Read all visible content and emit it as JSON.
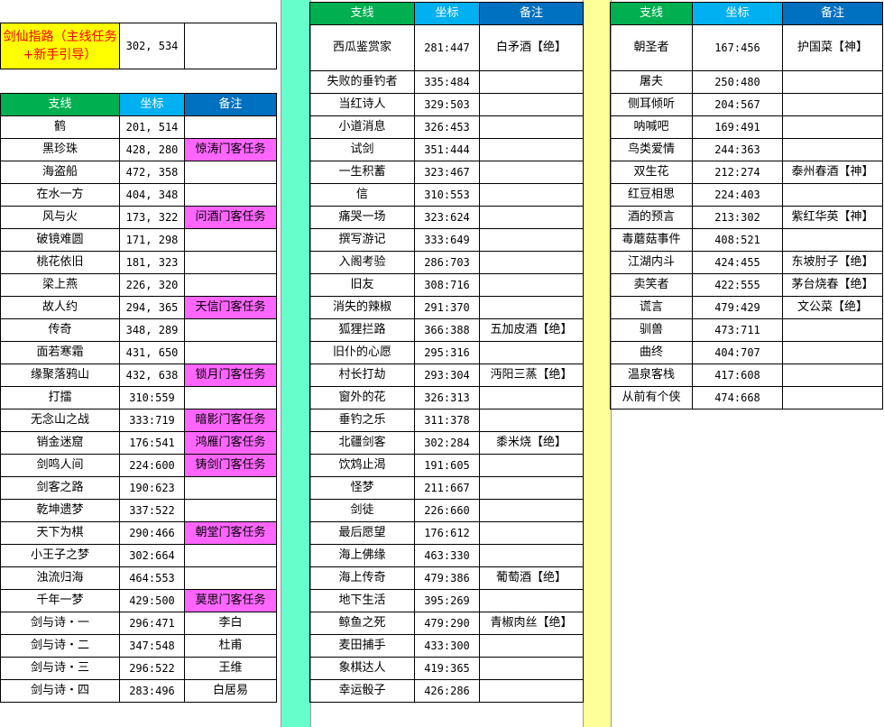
{
  "colors": {
    "header_green": "#00b050",
    "header_blue": "#00b0f0",
    "header_navy": "#0070c0",
    "mint_separator": "#66ffcc",
    "pale_yellow_separator": "#ffff99",
    "pink_note": "#ff66ff",
    "guide_yellow": "#ffff00",
    "guide_red_text": "#ff0000"
  },
  "guide": {
    "label": "剑仙指路（主线任务+新手引导）",
    "coord": "302, 534",
    "note": ""
  },
  "headers": {
    "branch": "支线",
    "coord": "坐标",
    "note": "备注"
  },
  "table1": [
    {
      "name": "鹤",
      "coord": "201, 514",
      "note": ""
    },
    {
      "name": "黑珍珠",
      "coord": "428, 280",
      "note": "惊涛门客任务"
    },
    {
      "name": "海盗船",
      "coord": "472, 358",
      "note": ""
    },
    {
      "name": "在水一方",
      "coord": "404, 348",
      "note": ""
    },
    {
      "name": "风与火",
      "coord": "173, 322",
      "note": "问酒门客任务"
    },
    {
      "name": "破镜难圆",
      "coord": "171, 298",
      "note": ""
    },
    {
      "name": "桃花依旧",
      "coord": "181, 323",
      "note": ""
    },
    {
      "name": "梁上燕",
      "coord": "226, 320",
      "note": ""
    },
    {
      "name": "故人约",
      "coord": "294, 365",
      "note": "天信门客任务"
    },
    {
      "name": "传奇",
      "coord": "348, 289",
      "note": ""
    },
    {
      "name": "面若寒霜",
      "coord": "431, 650",
      "note": ""
    },
    {
      "name": "缘聚落鸦山",
      "coord": "432, 638",
      "note": "锁月门客任务"
    },
    {
      "name": "打擂",
      "coord": "310:559",
      "note": ""
    },
    {
      "name": "无念山之战",
      "coord": "333:719",
      "note": "暗影门客任务"
    },
    {
      "name": "销金迷窟",
      "coord": "176:541",
      "note": "鸿雁门客任务"
    },
    {
      "name": "剑鸣人间",
      "coord": "224:600",
      "note": "铸剑门客任务"
    },
    {
      "name": "剑客之路",
      "coord": "190:623",
      "note": ""
    },
    {
      "name": "乾坤遗梦",
      "coord": "337:522",
      "note": ""
    },
    {
      "name": "天下为棋",
      "coord": "290:466",
      "note": "朝堂门客任务"
    },
    {
      "name": "小王子之梦",
      "coord": "302:664",
      "note": ""
    },
    {
      "name": "浊流归海",
      "coord": "464:553",
      "note": ""
    },
    {
      "name": "千年一梦",
      "coord": "429:500",
      "note": "莫思门客任务"
    },
    {
      "name": "剑与诗・一",
      "coord": "296:471",
      "note": "李白"
    },
    {
      "name": "剑与诗・二",
      "coord": "347:548",
      "note": "杜甫"
    },
    {
      "name": "剑与诗・三",
      "coord": "296:522",
      "note": "王维"
    },
    {
      "name": "剑与诗・四",
      "coord": "283:496",
      "note": "白居易"
    }
  ],
  "table2": [
    {
      "name": "西瓜鉴赏家",
      "coord": "281:447",
      "note": "白矛酒【绝】"
    },
    {
      "name": "失败的垂钓者",
      "coord": "335:484",
      "note": ""
    },
    {
      "name": "当红诗人",
      "coord": "329:503",
      "note": ""
    },
    {
      "name": "小道消息",
      "coord": "326:453",
      "note": ""
    },
    {
      "name": "试剑",
      "coord": "351:444",
      "note": ""
    },
    {
      "name": "一生积蓄",
      "coord": "323:467",
      "note": ""
    },
    {
      "name": "信",
      "coord": "310:553",
      "note": ""
    },
    {
      "name": "痛哭一场",
      "coord": "323:624",
      "note": ""
    },
    {
      "name": "撰写游记",
      "coord": "333:649",
      "note": ""
    },
    {
      "name": "入阁考验",
      "coord": "286:703",
      "note": ""
    },
    {
      "name": "旧友",
      "coord": "308:716",
      "note": ""
    },
    {
      "name": "消失的辣椒",
      "coord": "291:370",
      "note": ""
    },
    {
      "name": "狐狸拦路",
      "coord": "366:388",
      "note": "五加皮酒【绝】"
    },
    {
      "name": "旧仆的心愿",
      "coord": "295:316",
      "note": ""
    },
    {
      "name": "村长打劫",
      "coord": "293:304",
      "note": "沔阳三蒸【绝】"
    },
    {
      "name": "窗外的花",
      "coord": "326:313",
      "note": ""
    },
    {
      "name": "垂钓之乐",
      "coord": "311:378",
      "note": ""
    },
    {
      "name": "北疆剑客",
      "coord": "302:284",
      "note": "黍米烧【绝】"
    },
    {
      "name": "饮鸩止渴",
      "coord": "191:605",
      "note": ""
    },
    {
      "name": "怪梦",
      "coord": "211:667",
      "note": ""
    },
    {
      "name": "剑徒",
      "coord": "226:660",
      "note": ""
    },
    {
      "name": "最后愿望",
      "coord": "176:612",
      "note": ""
    },
    {
      "name": "海上佛缘",
      "coord": "463:330",
      "note": ""
    },
    {
      "name": "海上传奇",
      "coord": "479:386",
      "note": "葡萄酒【绝】"
    },
    {
      "name": "地下生活",
      "coord": "395:269",
      "note": ""
    },
    {
      "name": "鲸鱼之死",
      "coord": "479:290",
      "note": "青椒肉丝【绝】"
    },
    {
      "name": "麦田捕手",
      "coord": "433:300",
      "note": ""
    },
    {
      "name": "象棋达人",
      "coord": "419:365",
      "note": ""
    },
    {
      "name": "幸运骰子",
      "coord": "426:286",
      "note": ""
    }
  ],
  "table3": [
    {
      "name": "朝圣者",
      "coord": "167:456",
      "note": "护国菜【神】"
    },
    {
      "name": "屠夫",
      "coord": "250:480",
      "note": ""
    },
    {
      "name": "侧耳倾听",
      "coord": "204:567",
      "note": ""
    },
    {
      "name": "呐喊吧",
      "coord": "169:491",
      "note": ""
    },
    {
      "name": "鸟类爱情",
      "coord": "244:363",
      "note": ""
    },
    {
      "name": "双生花",
      "coord": "212:274",
      "note": "泰州春酒【神】"
    },
    {
      "name": "红豆相思",
      "coord": "224:403",
      "note": ""
    },
    {
      "name": "酒的预言",
      "coord": "213:302",
      "note": "紫红华英【神】"
    },
    {
      "name": "毒蘑菇事件",
      "coord": "408:521",
      "note": ""
    },
    {
      "name": "江湖内斗",
      "coord": "424:455",
      "note": "东坡肘子【绝】"
    },
    {
      "name": "卖笑者",
      "coord": "422:555",
      "note": "茅台烧春【绝】"
    },
    {
      "name": "谎言",
      "coord": "479:429",
      "note": "文公菜【绝】"
    },
    {
      "name": "驯兽",
      "coord": "473:711",
      "note": ""
    },
    {
      "name": "曲终",
      "coord": "404:707",
      "note": ""
    },
    {
      "name": "温泉客栈",
      "coord": "417:608",
      "note": ""
    },
    {
      "name": "从前有个侠",
      "coord": "474:668",
      "note": ""
    }
  ]
}
